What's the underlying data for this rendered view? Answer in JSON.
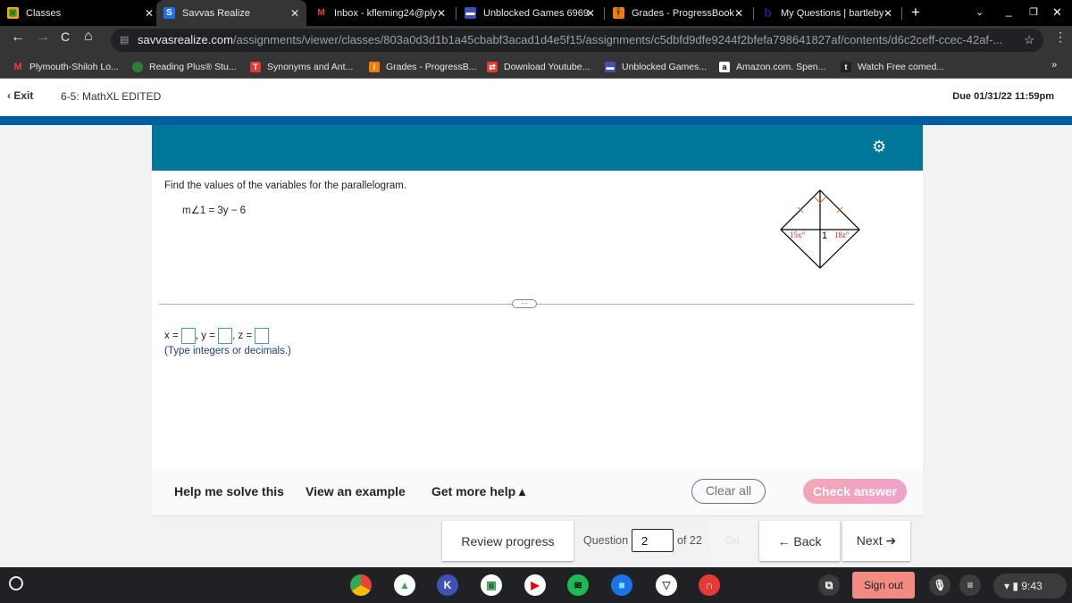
{
  "browser": {
    "tabs": [
      {
        "label": "Classes",
        "icon": "google-classroom-icon",
        "active": false
      },
      {
        "label": "Savvas Realize",
        "icon": "savvas-icon",
        "active": true
      },
      {
        "label": "Inbox - kfleming24@ply",
        "icon": "gmail-icon",
        "active": false
      },
      {
        "label": "Unblocked Games 6969",
        "icon": "unblocked-games-icon",
        "active": false
      },
      {
        "label": "Grades - ProgressBook",
        "icon": "progressbook-icon",
        "active": false
      },
      {
        "label": "My Questions | bartleby",
        "icon": "bartleby-icon",
        "active": false
      }
    ],
    "url_domain": "savvasrealize.com",
    "url_path": "/assignments/viewer/classes/803a0d3d1b1a45cbabf3acad1d4e5f15/assignments/c5dbfd9dfe9244f2bfefa798641827af/contents/d6c2ceff-ccec-42af-...",
    "bookmarks": [
      "Plymouth-Shiloh Lo...",
      "Reading Plus® Stu...",
      "Synonyms and Ant...",
      "Grades - ProgressB...",
      "Download Youtube...",
      "Unblocked Games...",
      "Amazon.com. Spen...",
      "Watch Free comed..."
    ]
  },
  "header": {
    "exit_label": "Exit",
    "title": "6-5: MathXL EDITED",
    "due": "Due 01/31/22 11:59pm"
  },
  "question": {
    "prompt": "Find the values of the variables for the parallelogram.",
    "given": "m∠1 = 3y − 6",
    "figure_labels": {
      "left": "15x°",
      "center": "1",
      "right": "18z°"
    },
    "answer_labels": [
      "x =",
      ", y =",
      ", z ="
    ],
    "hint": "(Type integers or decimals.)",
    "expand_label": "···"
  },
  "help": {
    "help_me_solve": "Help me solve this",
    "view_example": "View an example",
    "more_help": "Get more help ▴",
    "clear_all": "Clear all",
    "check_answer": "Check answer"
  },
  "footer": {
    "review_progress": "Review progress",
    "question_label": "Question",
    "question_number": "2",
    "of_total": "of 22",
    "go": "Go",
    "back": "← Back",
    "next": "Next ➔"
  },
  "shelf": {
    "sign_out": "Sign out",
    "time": "9:43"
  },
  "colors": {
    "teal": "#00779a",
    "blue_bar": "#005da0",
    "check_answer": "#f2a7bd",
    "sign_out": "#f28b82"
  }
}
